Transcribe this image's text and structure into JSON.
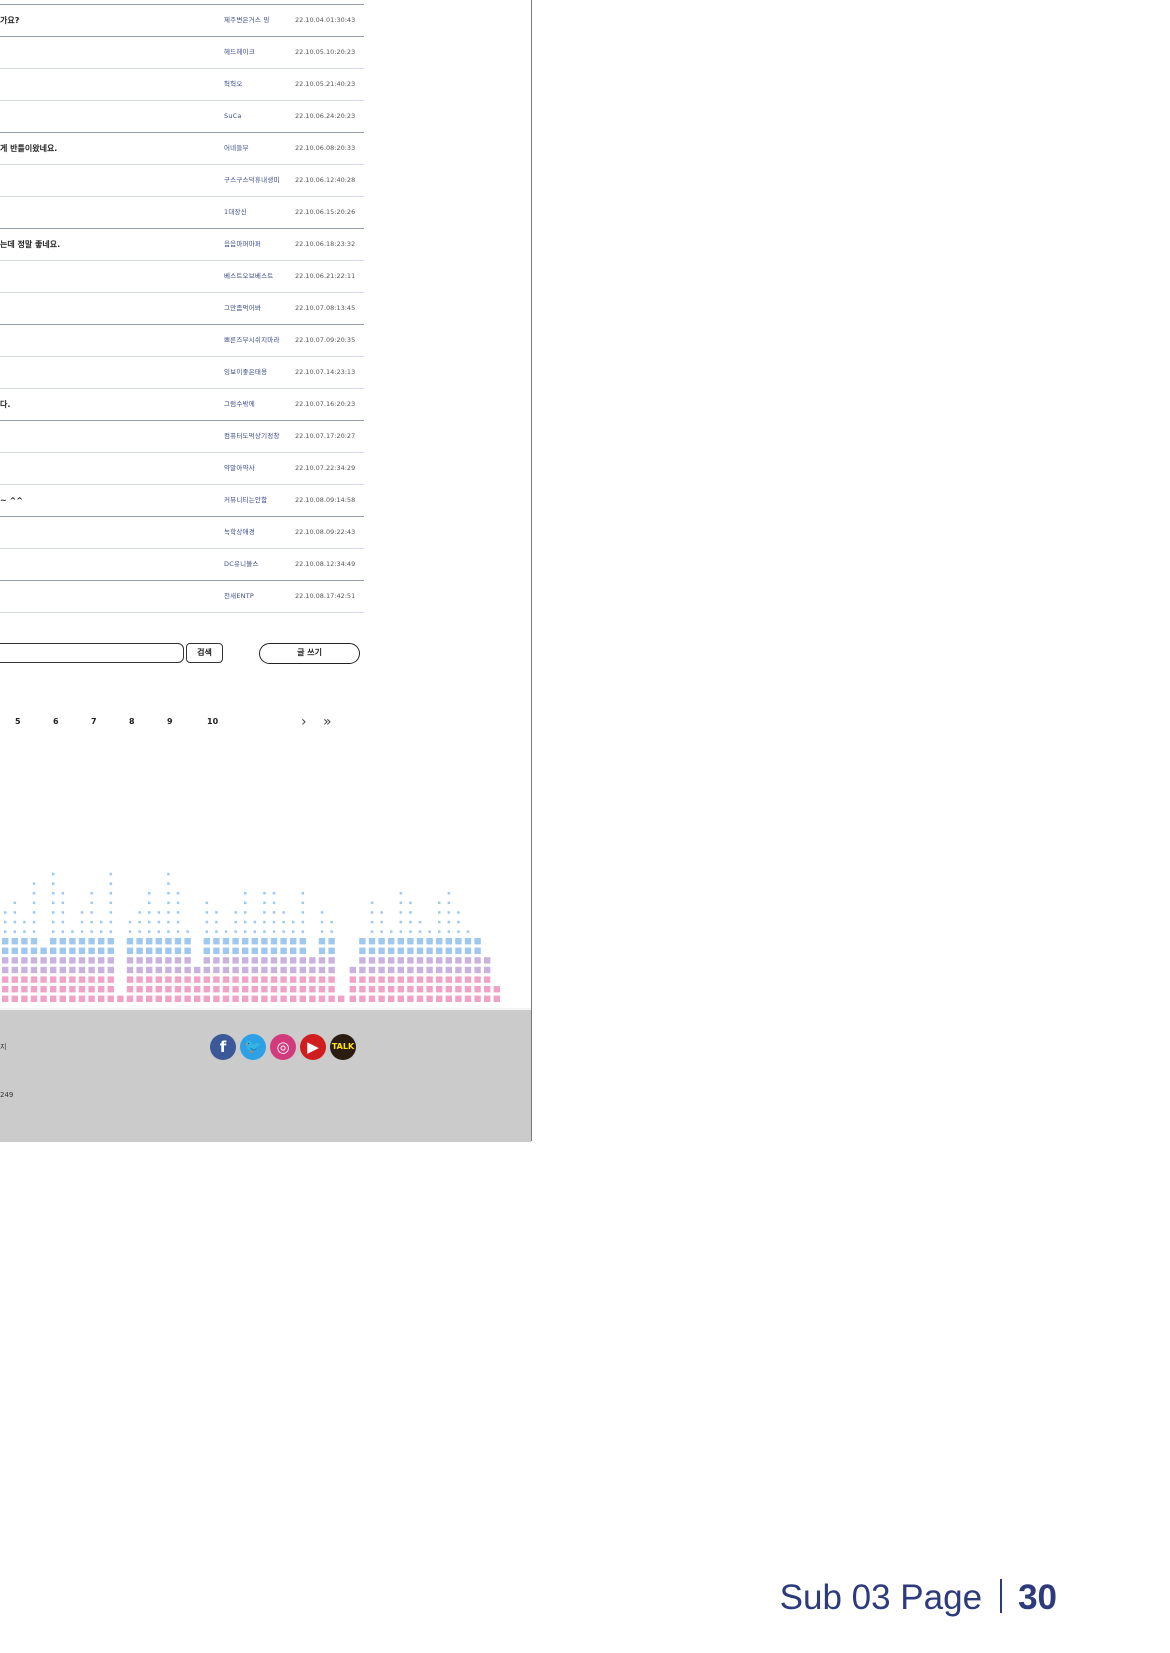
{
  "board": {
    "rows": [
      {
        "title": "가요?",
        "author": "제주변은거스 핑",
        "date": "22.10.04.01:30:43"
      },
      {
        "title": "",
        "author": "헤드헤이크",
        "date": "22.10.05.10:20:23"
      },
      {
        "title": "",
        "author": "헉헉오",
        "date": "22.10.05.21:40:23"
      },
      {
        "title": "",
        "author": "SuCa",
        "date": "22.10.06.24:20:23"
      },
      {
        "title": "게 반틀이왔네요.",
        "author": "어네들부",
        "date": "22.10.06.08:20:33"
      },
      {
        "title": "",
        "author": "구스구스덕휴내생미",
        "date": "22.10.06.12:40:28"
      },
      {
        "title": "",
        "author": "1대장신",
        "date": "22.10.06.15:20:26"
      },
      {
        "title": "는데 정말 좋네요.",
        "author": "음음마퍼마퍼",
        "date": "22.10.06.18:23:32"
      },
      {
        "title": "",
        "author": "베스트오브베스트",
        "date": "22.10.06.21:22:11"
      },
      {
        "title": "",
        "author": "그만좀먹어봐",
        "date": "22.10.07.08:13:45"
      },
      {
        "title": "",
        "author": "쁘른즈부시쉬지마라",
        "date": "22.10.07.09:20:35"
      },
      {
        "title": "",
        "author": "잉보이좋은태용",
        "date": "22.10.07.14:23:13"
      },
      {
        "title": "다.",
        "author": "그럼수밖에",
        "date": "22.10.07.16:20:23"
      },
      {
        "title": "",
        "author": "컴퓨터도먹상기정창",
        "date": "22.10.07.17:20:27"
      },
      {
        "title": "",
        "author": "약말아약사",
        "date": "22.10.07.22:34:29"
      },
      {
        "title": "~ ^^",
        "author": "커뮤니티는안함",
        "date": "22.10.08.09:14:58"
      },
      {
        "title": "",
        "author": "녹학상애경",
        "date": "22.10.08.09:22:43"
      },
      {
        "title": "",
        "author": "DC유니볼스",
        "date": "22.10.08.12:34:49"
      },
      {
        "title": "",
        "author": "천새ENTP",
        "date": "22.10.08.17:42:51"
      }
    ]
  },
  "search": {
    "button_label": "검색",
    "placeholder": ""
  },
  "write": {
    "button_label": "글 쓰기"
  },
  "pagination": {
    "pages": [
      "5",
      "6",
      "7",
      "8",
      "9",
      "10"
    ],
    "next": "›",
    "last": "»"
  },
  "footer": {
    "line1": "지",
    "line2": "249"
  },
  "social": {
    "facebook": "f",
    "twitter": "🐦",
    "instagram": "◎",
    "youtube": "▶",
    "kakaotalk": "TALK"
  },
  "colors": {
    "accent": "#2d3a7c",
    "eq_pink": "#f0a3c6",
    "eq_blue": "#9ec8ee",
    "footer_bg": "#cbcbcb"
  },
  "page_label": {
    "text": "Sub 03 Page",
    "number": "30"
  }
}
